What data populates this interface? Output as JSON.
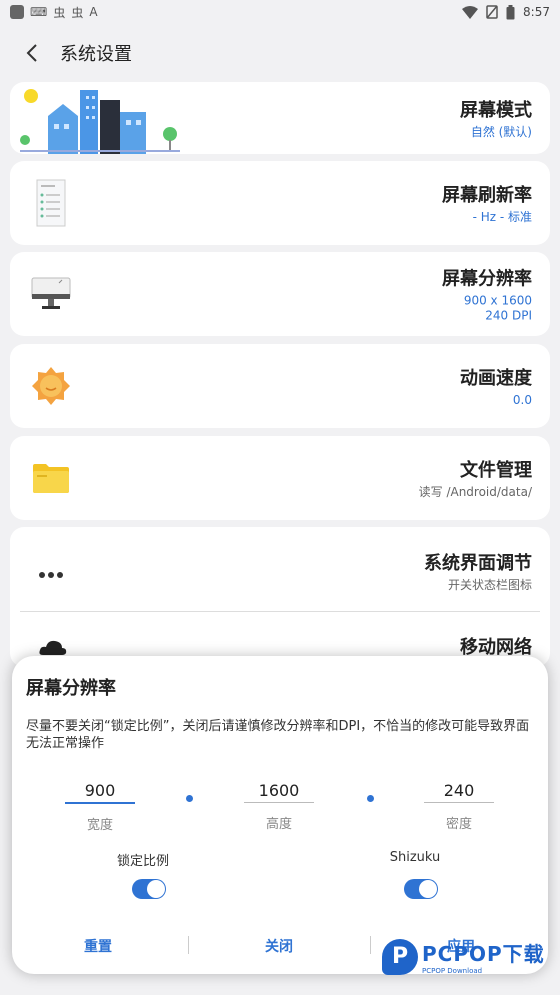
{
  "status": {
    "time": "8:57",
    "glyphs": [
      "⌨",
      "虫",
      "虫",
      "A"
    ]
  },
  "header": {
    "title": "系统设置"
  },
  "cards": [
    {
      "title": "屏幕模式",
      "sub": "自然 (默认)",
      "icon": "city-icon"
    },
    {
      "title": "屏幕刷新率",
      "sub": "- Hz - 标准",
      "icon": "document-list-icon"
    },
    {
      "title": "屏幕分辨率",
      "sub": "900 x 1600",
      "sub2": "240 DPI",
      "icon": "monitor-icon"
    },
    {
      "title": "动画速度",
      "sub": "0.0",
      "icon": "sun-gear-icon"
    },
    {
      "title": "文件管理",
      "sub": "读写 /Android/data/",
      "icon": "folder-icon"
    },
    {
      "title": "系统界面调节",
      "sub": "开关状态栏图标",
      "icon": "dots-icon"
    },
    {
      "title": "移动网络",
      "sub": "",
      "icon": "cloud-icon"
    }
  ],
  "dialog": {
    "title": "屏幕分辨率",
    "message": "尽量不要关闭“锁定比例”，关闭后请谨慎修改分辨率和DPI，不恰当的修改可能导致界面无法正常操作",
    "width_value": "900",
    "width_label": "宽度",
    "height_value": "1600",
    "height_label": "高度",
    "density_value": "240",
    "density_label": "密度",
    "lock_label": "锁定比例",
    "shizuku_label": "Shizuku",
    "lock_on": true,
    "shizuku_on": true,
    "reset_label": "重置",
    "close_label": "关闭",
    "apply_label": "应用"
  },
  "watermark": {
    "logo": "P",
    "brand": "PCPOP下载",
    "sub": "PCPOP Download"
  },
  "colors": {
    "accent": "#2f73d3"
  }
}
